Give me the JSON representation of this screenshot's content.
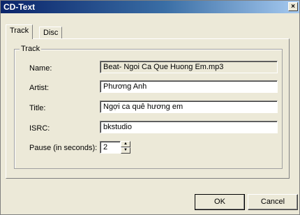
{
  "window": {
    "title": "CD-Text",
    "close_glyph": "×"
  },
  "tabs": [
    {
      "label": "Track",
      "selected": true
    },
    {
      "label": "Disc",
      "selected": false
    }
  ],
  "group": {
    "label": "Track"
  },
  "fields": {
    "name": {
      "label": "Name:",
      "value": "Beat- Ngoi Ca Que Huong Em.mp3"
    },
    "artist": {
      "label": "Artist:",
      "value": "Phương Anh"
    },
    "title": {
      "label": "Title:",
      "value": "Ngợi ca quê hương em"
    },
    "isrc": {
      "label": "ISRC:",
      "value": "bkstudio"
    },
    "pause": {
      "label": "Pause (in seconds):",
      "value": "2"
    }
  },
  "spinner": {
    "up_glyph": "▲",
    "down_glyph": "▼"
  },
  "buttons": {
    "ok": "OK",
    "cancel": "Cancel"
  }
}
